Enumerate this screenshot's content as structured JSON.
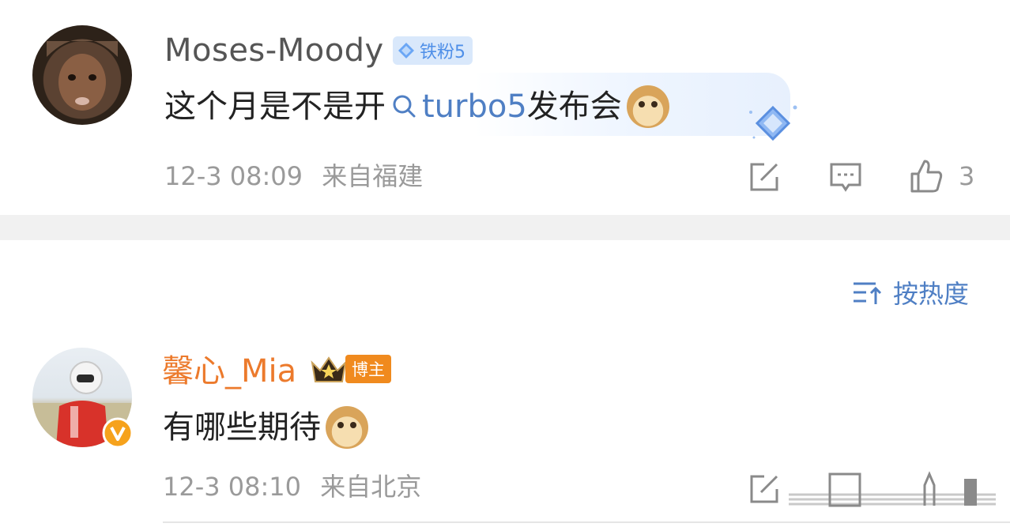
{
  "comments": [
    {
      "username": "Moses-Moody",
      "fan_badge": "铁粉5",
      "text_before": "这个月是不是开",
      "topic": "turbo5",
      "text_after": "发布会",
      "emoji": "doge-emoji",
      "time": "12-3 08:09",
      "location": "来自福建",
      "like_count": "3"
    },
    {
      "username": "馨心_Mia",
      "role_badge": "博主",
      "text": "有哪些期待",
      "emoji": "doge-emoji",
      "time": "12-3 08:10",
      "location": "来自北京"
    }
  ],
  "sort": {
    "label": "按热度"
  },
  "colors": {
    "username_gray": "#555555",
    "username_orange": "#ec7a2c",
    "link_blue": "#4f7fc4",
    "meta_gray": "#9a9a9a",
    "badge_orange": "#f08a1e"
  }
}
